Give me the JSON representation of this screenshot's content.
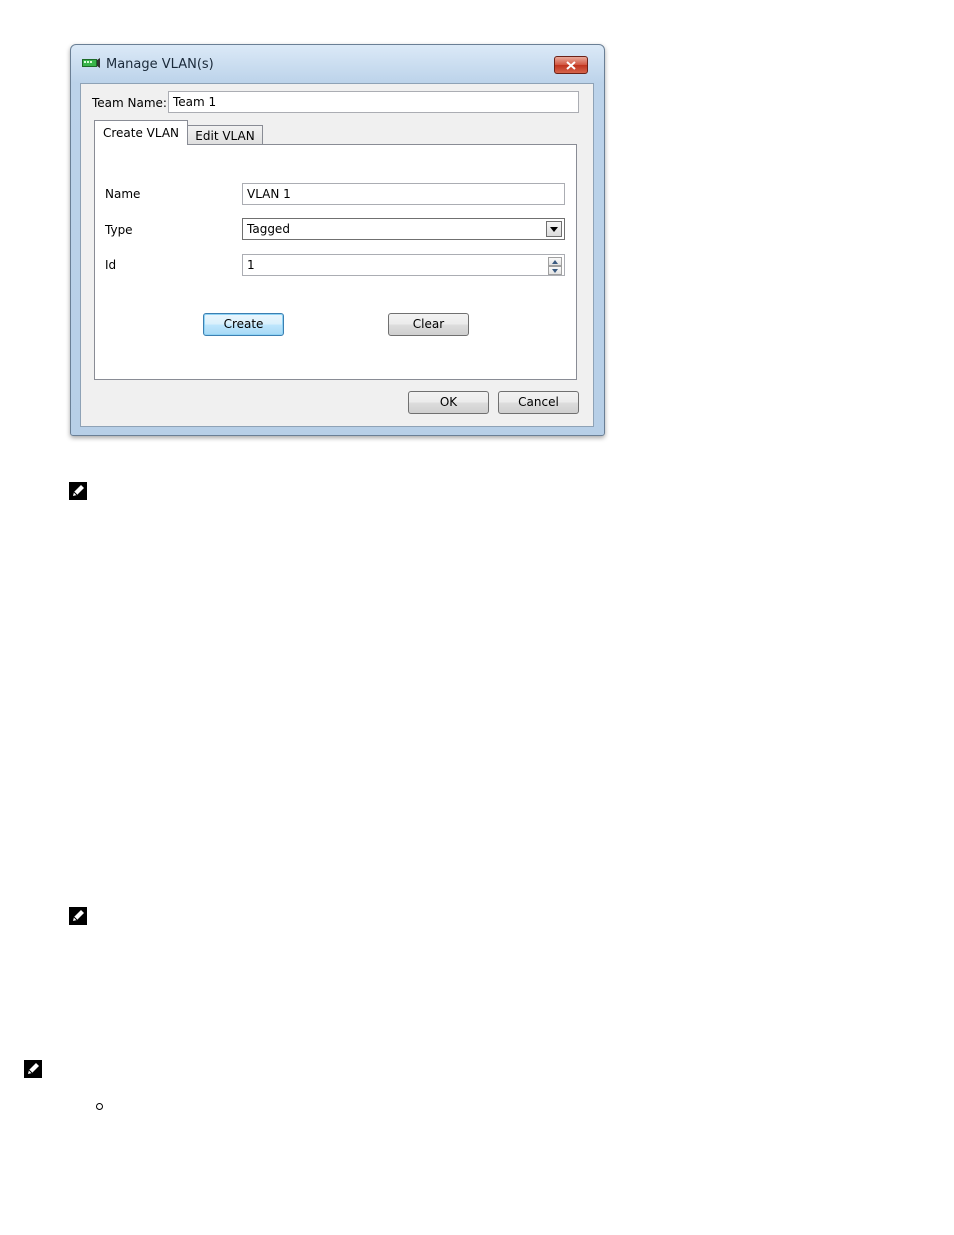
{
  "dialog": {
    "title": "Manage VLAN(s)",
    "close_icon": "close-icon",
    "team_name_label": "Team Name:",
    "team_name_value": "Team 1",
    "tabs": [
      {
        "label": "Create VLAN",
        "active": true
      },
      {
        "label": "Edit VLAN",
        "active": false
      }
    ],
    "form": {
      "name_label": "Name",
      "name_value": "VLAN 1",
      "type_label": "Type",
      "type_value": "Tagged",
      "id_label": "Id",
      "id_value": "1"
    },
    "buttons": {
      "create": "Create",
      "clear": "Clear",
      "ok": "OK",
      "cancel": "Cancel"
    }
  },
  "page": {
    "note_icon": "pencil-note-icon",
    "bullet_icon": "hollow-bullet-icon"
  },
  "colors": {
    "title_bar": "#bcd3ea",
    "close_button": "#c0341e",
    "default_button_border": "#3c7fb1"
  }
}
